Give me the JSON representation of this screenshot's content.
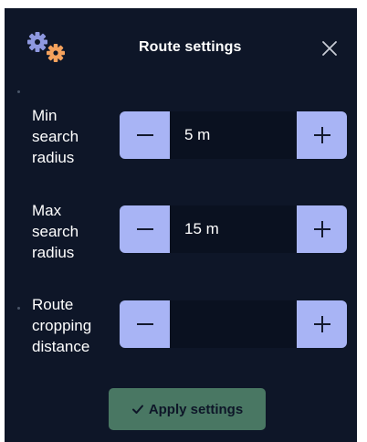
{
  "header": {
    "title": "Route settings",
    "icon": "gears-icon",
    "close_icon": "close-icon"
  },
  "settings": [
    {
      "label_lines": [
        "Min",
        "search",
        "radius"
      ],
      "value": "5 m",
      "minus_icon": "minus-icon",
      "plus_icon": "plus-icon"
    },
    {
      "label_lines": [
        "Max",
        "search",
        "radius"
      ],
      "value": "15 m",
      "minus_icon": "minus-icon",
      "plus_icon": "plus-icon"
    },
    {
      "label_lines": [
        "Route",
        "cropping",
        "distance"
      ],
      "value": "",
      "minus_icon": "minus-icon",
      "plus_icon": "plus-icon"
    }
  ],
  "apply": {
    "check_icon": "check-icon",
    "label": "Apply settings"
  },
  "colors": {
    "panel_bg": "#0e1628",
    "stepper_button": "#a8b4f5",
    "input_bg": "#0a1120",
    "apply_button": "#4e8068",
    "gear_primary": "#8e98e0",
    "gear_accent": "#f5a25d"
  }
}
